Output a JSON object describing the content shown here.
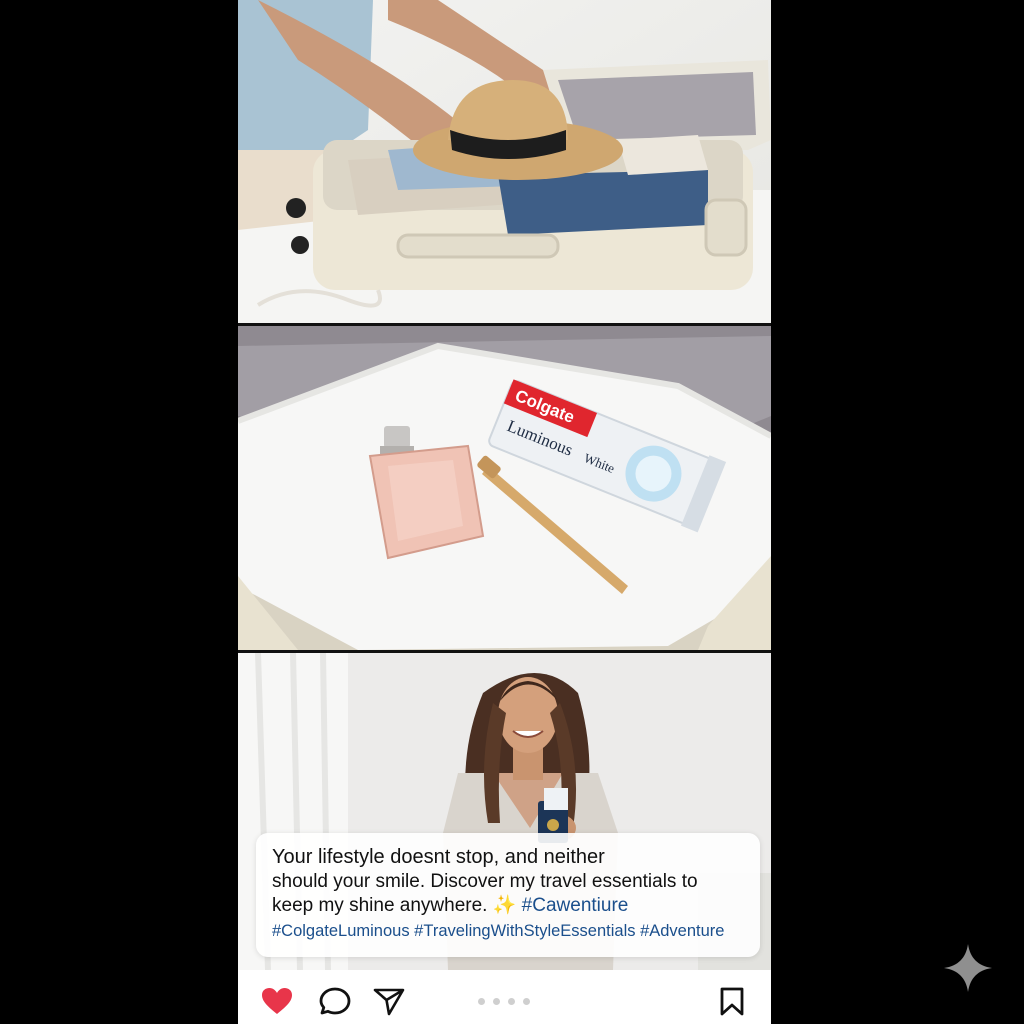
{
  "caption": {
    "line1": "Your lifestyle doesnt stop, and neither",
    "line2": "should your smile. Discover my travel essentials to",
    "line3": "keep my shine anywhere. ✨",
    "line3_tag": "#Cawentiure",
    "hashtags": "#ColgateLuminous #TravelingWithStyleEssentials #Adventure"
  },
  "toothpaste": {
    "brand": "Colgate",
    "line": "Luminous",
    "variant": "White"
  },
  "icons": {
    "like": "heart-icon",
    "comment": "comment-icon",
    "share": "send-icon",
    "save": "bookmark-icon",
    "watermark": "sparkle-icon"
  },
  "colors": {
    "like": "#e8354a",
    "hashtag": "#1b4f8c",
    "background": "#000000"
  },
  "carousel": {
    "slides": 4,
    "active": 1
  }
}
